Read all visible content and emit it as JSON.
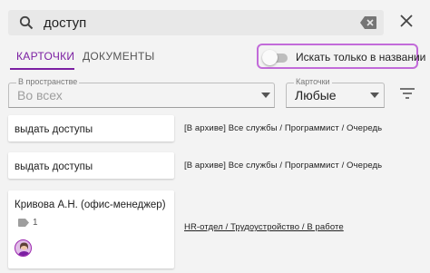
{
  "search": {
    "value": "доступ"
  },
  "tabs": [
    {
      "label": "КАРТОЧКИ",
      "active": true
    },
    {
      "label": "ДОКУМЕНТЫ",
      "active": false
    }
  ],
  "toggle": {
    "label": "Искать только в названии",
    "checked": false
  },
  "filters": {
    "space": {
      "label": "В пространстве",
      "value": "Во всех"
    },
    "cards": {
      "label": "Карточки",
      "value": "Любые"
    }
  },
  "results": [
    {
      "title": "выдать доступы",
      "path": "[В архиве] Все службы / Программист / Очередь"
    },
    {
      "title": "выдать доступы",
      "path": "[В архиве] Все службы / Программист / Очередь"
    },
    {
      "title": "Кривова А.Н. (офис-менеджер)",
      "tag_count": "1",
      "path": "HR-отдел / Трудоустройство / В работе"
    }
  ],
  "colors": {
    "accent": "#7b1fa2",
    "toggle_outline": "#c26bd9",
    "background": "#f3f3f3"
  },
  "icons": [
    "search-icon",
    "clear-icon",
    "close-icon",
    "chevron-down-icon",
    "filter-icon",
    "tag-icon",
    "avatar"
  ]
}
